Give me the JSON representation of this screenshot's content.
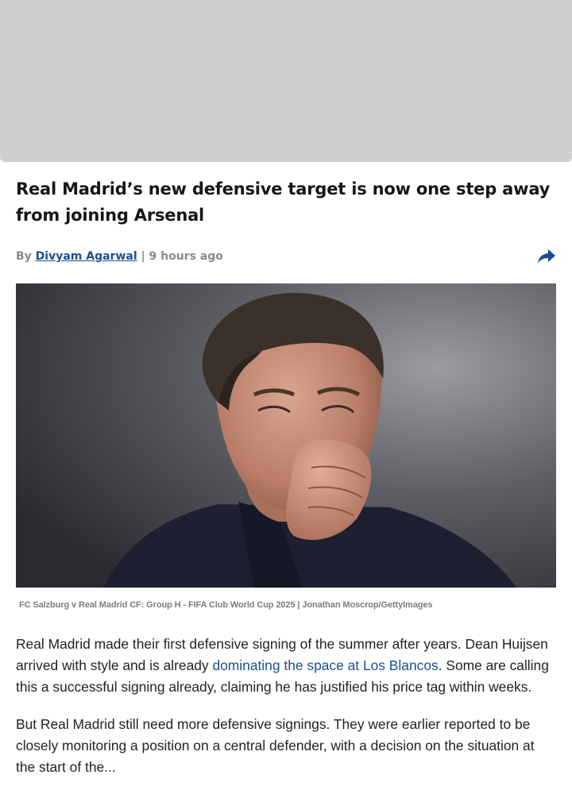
{
  "article": {
    "headline": "Real Madrid’s new defensive target is now one step away from joining Arsenal",
    "byline": {
      "prefix": "By ",
      "author": "Divyam Agarwal",
      "separator": " | ",
      "time": "9 hours ago"
    },
    "share_icon": "share-arrow-icon",
    "image_caption": "FC Salzburg v Real Madrid CF: Group H - FIFA Club World Cup 2025 | Jonathan Moscrop/GettyImages",
    "paragraph1": {
      "before": "Real Madrid made their first defensive signing of the summer after years. Dean Huijsen arrived with style and is already ",
      "link": "dominating the space at Los Blancos",
      "after": ". Some are calling this a successful signing already, claiming he has justified his price tag within weeks."
    },
    "paragraph2": {
      "text": "But Real Madrid still need more defensive signings. They were earlier reported to be closely monitoring a position on a central defender, with a decision on the situation at the start of the..."
    }
  },
  "colors": {
    "link": "#1a4f8f",
    "ad_placeholder": "#cfcfcf",
    "meta_gray": "#8a8a8a"
  }
}
